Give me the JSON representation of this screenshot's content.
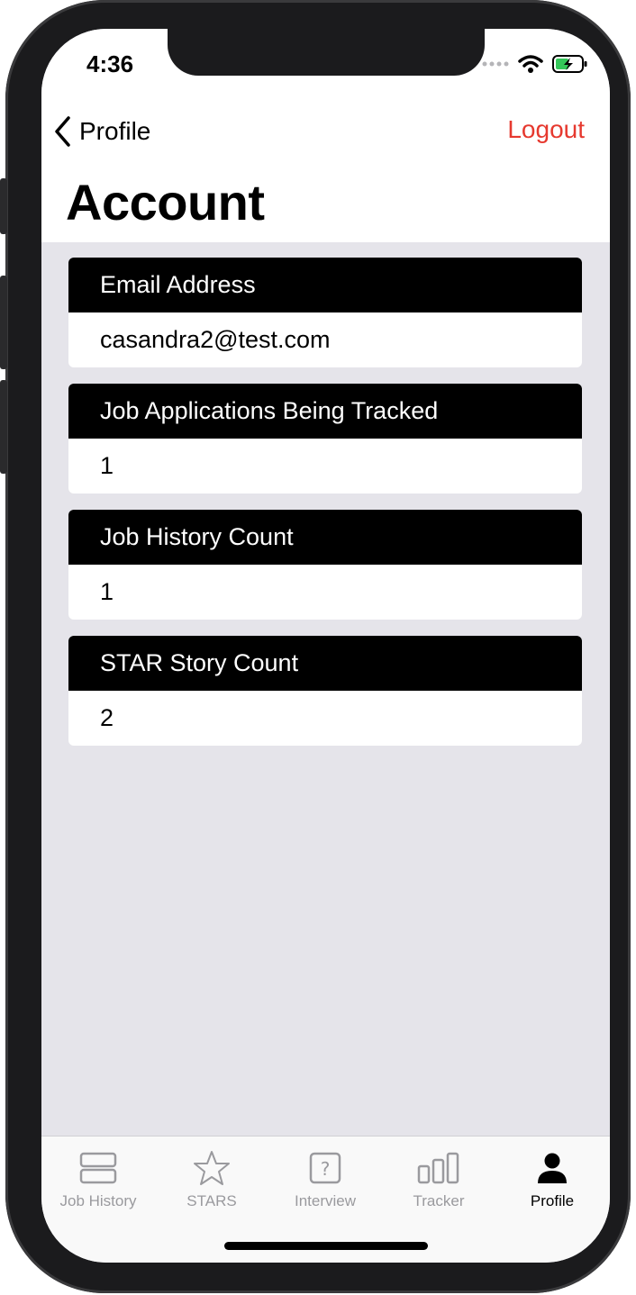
{
  "status_bar": {
    "time": "4:36"
  },
  "nav": {
    "back_label": "Profile",
    "logout_label": "Logout",
    "title": "Account"
  },
  "cards": [
    {
      "header": "Email Address",
      "value": "casandra2@test.com"
    },
    {
      "header": "Job Applications Being Tracked",
      "value": "1"
    },
    {
      "header": "Job History Count",
      "value": "1"
    },
    {
      "header": "STAR Story Count",
      "value": "2"
    }
  ],
  "tabs": [
    {
      "label": "Job History",
      "icon": "job-history-icon"
    },
    {
      "label": "STARS",
      "icon": "star-icon"
    },
    {
      "label": "Interview",
      "icon": "question-box-icon"
    },
    {
      "label": "Tracker",
      "icon": "bar-chart-icon"
    },
    {
      "label": "Profile",
      "icon": "person-icon",
      "active": true
    }
  ],
  "colors": {
    "accent_logout": "#e6392f",
    "background": "#e5e4ea",
    "card_header": "#000000"
  }
}
